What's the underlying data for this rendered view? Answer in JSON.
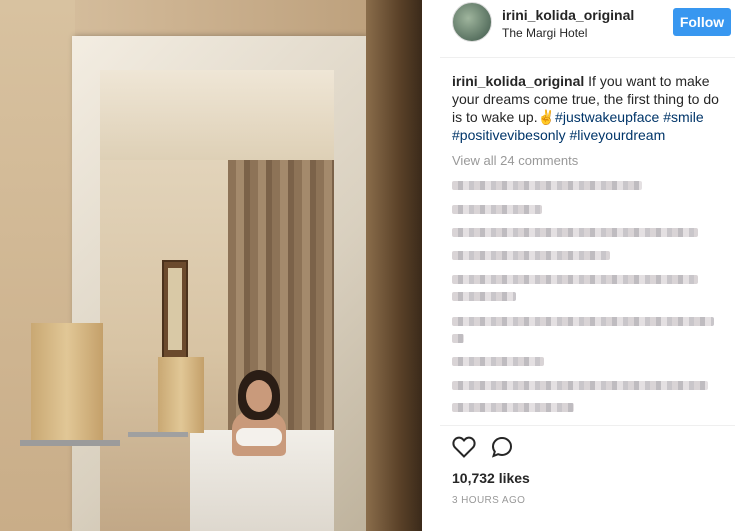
{
  "post": {
    "username": "irini_kolida_original",
    "location": "The Margi Hotel",
    "follow_label": "Follow",
    "caption_user": "irini_kolida_original",
    "caption_text": "If you want to make your dreams come true, the first thing to do is to wake up.",
    "caption_emoji": "✌",
    "tags": [
      "#justwakeupface",
      "#smile",
      "#positivevibesonly",
      "#liveyourdream"
    ],
    "view_all_comments": "View all 24 comments",
    "likes": "10,732 likes",
    "timestamp": "3 HOURS AGO"
  },
  "icons": {
    "like": "heart-icon",
    "comment": "comment-icon"
  },
  "colors": {
    "follow_button": "#3897f0",
    "hashtag": "#003569",
    "muted": "#999999"
  }
}
